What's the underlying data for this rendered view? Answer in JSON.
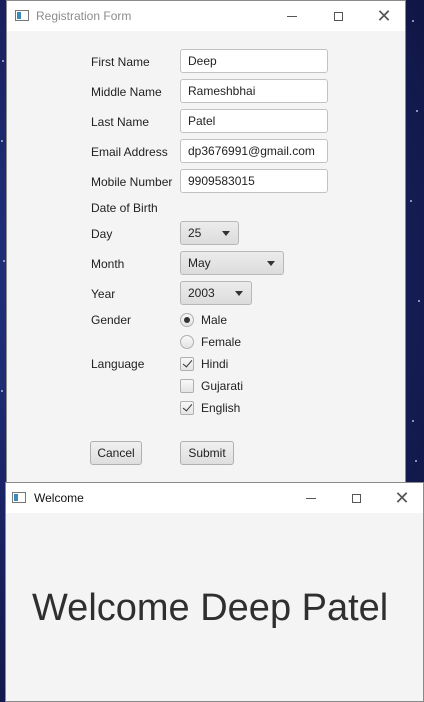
{
  "registration_window": {
    "title": "Registration Form",
    "labels": {
      "first_name": "First Name",
      "middle_name": "Middle Name",
      "last_name": "Last Name",
      "email": "Email Address",
      "mobile": "Mobile Number",
      "dob": "Date of Birth",
      "day": "Day",
      "month": "Month",
      "year": "Year",
      "gender": "Gender",
      "language": "Language"
    },
    "values": {
      "first_name": "Deep",
      "middle_name": "Rameshbhai",
      "last_name": "Patel",
      "email": "dp3676991@gmail.com",
      "mobile": "9909583015",
      "day": "25",
      "month": "May",
      "year": "2003"
    },
    "gender_options": [
      {
        "label": "Male",
        "selected": true
      },
      {
        "label": "Female",
        "selected": false
      }
    ],
    "language_options": [
      {
        "label": "Hindi",
        "checked": true
      },
      {
        "label": "Gujarati",
        "checked": false
      },
      {
        "label": "English",
        "checked": true
      }
    ],
    "buttons": {
      "cancel": "Cancel",
      "submit": "Submit"
    }
  },
  "welcome_window": {
    "title": "Welcome",
    "message": "Welcome Deep Patel"
  },
  "colors": {
    "window_bg": "#f4f4f4",
    "desktop_bg": "#1a2466"
  }
}
